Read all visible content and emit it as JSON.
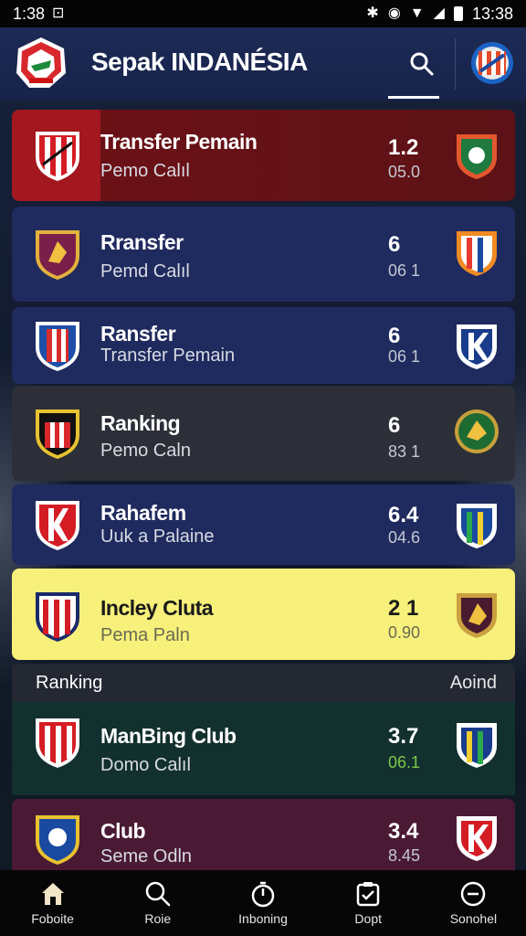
{
  "status_bar": {
    "time_left": "1:38",
    "time_right": "13:38"
  },
  "header": {
    "title": "Sepak INDANÉSIA"
  },
  "cards": [
    {
      "title": "Transfer Pemain",
      "subtitle": "Pemo Calıl",
      "score": "1.2",
      "small": "05.0"
    },
    {
      "title": "Rransfer",
      "subtitle": "Pemd Calıl",
      "score": "6",
      "small": "06 1"
    },
    {
      "title": "Ransfer",
      "subtitle": "Transfer Pemain",
      "score": "6",
      "small": "06 1"
    },
    {
      "title": "Ranking",
      "subtitle": "Pemo Caln",
      "score": "6",
      "small": "83 1"
    },
    {
      "title": "Rahafem",
      "subtitle": "Uuk a Palaine",
      "score": "6.4",
      "small": "04.6"
    },
    {
      "title": "Incley Cluta",
      "subtitle": "Pema Paln",
      "score": "2 1",
      "small": "0.90"
    },
    {
      "title": "ManBing Club",
      "subtitle": "Domo Calıl",
      "score": "3.7",
      "small": "06.1"
    },
    {
      "title": "Club",
      "subtitle": "Seme Odln",
      "score": "3.4",
      "small": "8.45"
    }
  ],
  "section": {
    "left_label": "Ranking",
    "right_label": "Aoind"
  },
  "bottom_nav": [
    {
      "label": "Foboite"
    },
    {
      "label": "Roie"
    },
    {
      "label": "Inboning"
    },
    {
      "label": "Dopt"
    },
    {
      "label": "Sonohel"
    }
  ]
}
